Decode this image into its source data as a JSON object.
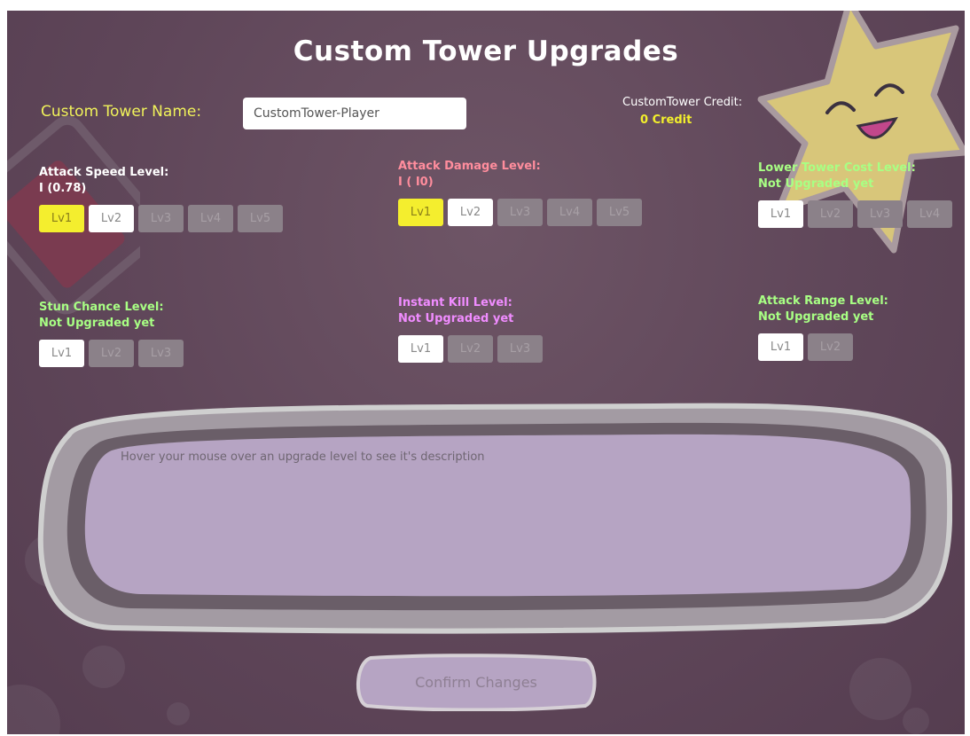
{
  "title": "Custom Tower Upgrades",
  "tower_name": {
    "label": "Custom Tower Name:",
    "value": "CustomTower-Player"
  },
  "credit": {
    "label": "CustomTower Credit:",
    "value": "0 Credit"
  },
  "colors": {
    "owned": "#f4ee2e",
    "next": "#ffffff",
    "locked": "#8b8189",
    "attack_speed": "#ffffff",
    "attack_damage": "#ff8d9d",
    "lower_cost": "#a8ff84",
    "stun": "#a8ff84",
    "instant_kill": "#f08cff",
    "range": "#a8ff84",
    "name_label": "#f0f25a",
    "credit_value": "#f3f02c"
  },
  "upgrades": {
    "attack_speed": {
      "title": "Attack Speed Level:",
      "value": "I (0.78)",
      "levels": [
        "Lv1",
        "Lv2",
        "Lv3",
        "Lv4",
        "Lv5"
      ],
      "states": [
        "owned",
        "next",
        "locked",
        "locked",
        "locked"
      ]
    },
    "attack_damage": {
      "title": "Attack Damage Level:",
      "value": "I ( I0)",
      "levels": [
        "Lv1",
        "Lv2",
        "Lv3",
        "Lv4",
        "Lv5"
      ],
      "states": [
        "owned",
        "next",
        "locked",
        "locked",
        "locked"
      ]
    },
    "lower_cost": {
      "title": "Lower Tower Cost Level:",
      "value": "Not Upgraded yet",
      "levels": [
        "Lv1",
        "Lv2",
        "Lv3",
        "Lv4"
      ],
      "states": [
        "next",
        "locked",
        "locked",
        "locked"
      ]
    },
    "stun": {
      "title": "Stun Chance Level:",
      "value": "Not Upgraded yet",
      "levels": [
        "Lv1",
        "Lv2",
        "Lv3"
      ],
      "states": [
        "next",
        "locked",
        "locked"
      ]
    },
    "instant_kill": {
      "title": "Instant Kill Level:",
      "value": "Not Upgraded yet",
      "levels": [
        "Lv1",
        "Lv2",
        "Lv3"
      ],
      "states": [
        "next",
        "locked",
        "locked"
      ]
    },
    "range": {
      "title": "Attack Range Level:",
      "value": "Not Upgraded yet",
      "levels": [
        "Lv1",
        "Lv2"
      ],
      "states": [
        "next",
        "locked"
      ]
    }
  },
  "description": "Hover your mouse over an upgrade level to see it's description",
  "confirm_label": "Confirm Changes"
}
